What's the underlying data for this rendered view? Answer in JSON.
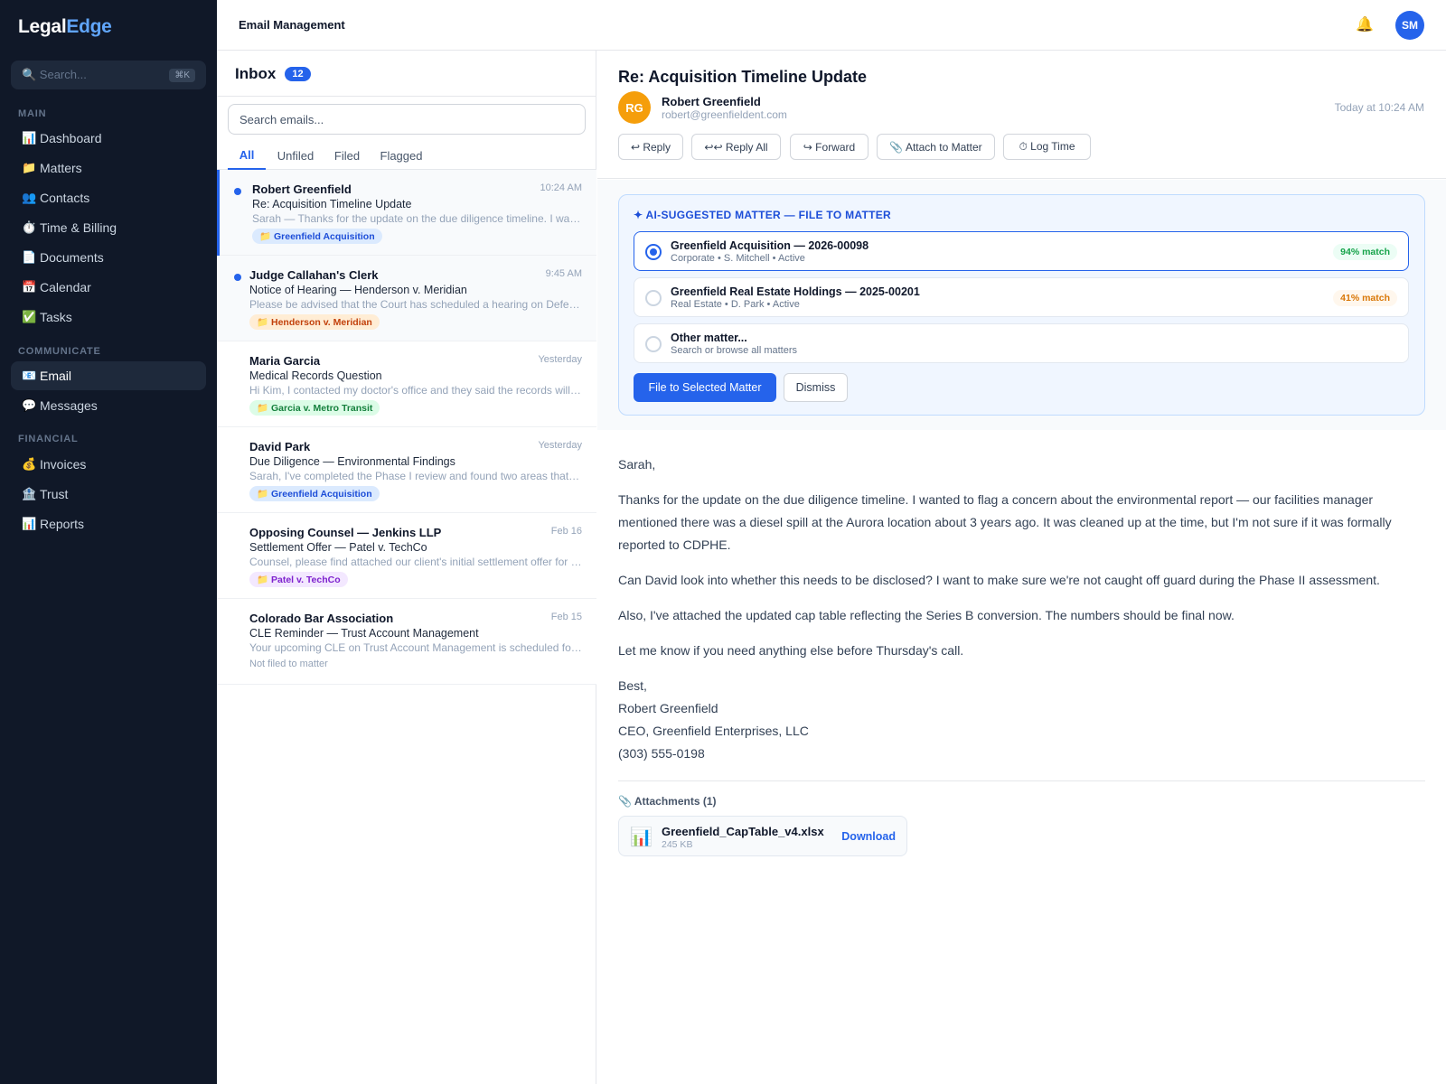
{
  "brand": {
    "part1": "Legal",
    "part2": "Edge"
  },
  "sidebar": {
    "search_placeholder": "🔍 Search...",
    "search_shortcut": "⌘K",
    "sections": {
      "main": "MAIN",
      "communicate": "COMMUNICATE",
      "financial": "FINANCIAL"
    },
    "items": [
      {
        "icon": "📊",
        "label": "Dashboard"
      },
      {
        "icon": "📁",
        "label": "Matters"
      },
      {
        "icon": "👥",
        "label": "Contacts"
      },
      {
        "icon": "⏱️",
        "label": "Time & Billing"
      },
      {
        "icon": "📄",
        "label": "Documents"
      },
      {
        "icon": "📅",
        "label": "Calendar"
      },
      {
        "icon": "✅",
        "label": "Tasks"
      },
      {
        "icon": "📧",
        "label": "Email"
      },
      {
        "icon": "💬",
        "label": "Messages"
      },
      {
        "icon": "💰",
        "label": "Invoices"
      },
      {
        "icon": "🏦",
        "label": "Trust"
      },
      {
        "icon": "📊",
        "label": "Reports"
      }
    ]
  },
  "topbar": {
    "title": "Email Management",
    "bell": "🔔",
    "avatar": "SM"
  },
  "inbox": {
    "title": "Inbox",
    "count": "12",
    "search_placeholder": "Search emails...",
    "tabs": [
      {
        "label": "All"
      },
      {
        "label": "Unfiled"
      },
      {
        "label": "Filed"
      },
      {
        "label": "Flagged"
      }
    ]
  },
  "emails": [
    {
      "sender": "Robert Greenfield",
      "time": "10:24 AM",
      "subject": "Re: Acquisition Timeline Update",
      "preview": "Sarah — Thanks for the update on the due diligence timeline. I wanted to flag a concern about the environmental report",
      "tag": "📁 Greenfield Acquisition"
    },
    {
      "sender": "Judge Callahan's Clerk",
      "time": "9:45 AM",
      "subject": "Notice of Hearing — Henderson v. Meridian",
      "preview": "Please be advised that the Court has scheduled a hearing on Defendant's motion",
      "tag": "📁 Henderson v. Meridian"
    },
    {
      "sender": "Maria Garcia",
      "time": "Yesterday",
      "subject": "Medical Records Question",
      "preview": "Hi Kim, I contacted my doctor's office and they said the records will take two weeks",
      "tag": "📁 Garcia v. Metro Transit"
    },
    {
      "sender": "David Park",
      "time": "Yesterday",
      "subject": "Due Diligence — Environmental Findings",
      "preview": "Sarah, I've completed the Phase I review and found two areas that need attention",
      "tag": "📁 Greenfield Acquisition"
    },
    {
      "sender": "Opposing Counsel — Jenkins LLP",
      "time": "Feb 16",
      "subject": "Settlement Offer — Patel v. TechCo",
      "preview": "Counsel, please find attached our client's initial settlement offer for your consideration",
      "tag": "📁 Patel v. TechCo"
    },
    {
      "sender": "Colorado Bar Association",
      "time": "Feb 15",
      "subject": "CLE Reminder — Trust Account Management",
      "preview": "Your upcoming CLE on Trust Account Management is scheduled for next week",
      "status": "Not filed to matter"
    }
  ],
  "detail": {
    "subject": "Re: Acquisition Timeline Update",
    "avatar": "RG",
    "from_name": "Robert Greenfield",
    "from_email": "robert@greenfieldent.com",
    "time": "Today at 10:24 AM",
    "actions": {
      "reply": "↩ Reply",
      "reply_all": "↩↩ Reply All",
      "forward": "↪ Forward",
      "attach": "📎 Attach to Matter",
      "log_time": "⏱ Log Time"
    }
  },
  "ai_panel": {
    "title": "✦ AI-SUGGESTED MATTER — FILE TO MATTER",
    "options": [
      {
        "name": "Greenfield Acquisition — 2026-00098",
        "meta": "Corporate • S. Mitchell • Active",
        "match": "94% match",
        "selected": true
      },
      {
        "name": "Greenfield Real Estate Holdings — 2025-00201",
        "meta": "Real Estate • D. Park • Active",
        "match": "41% match",
        "selected": false
      },
      {
        "name": "Other matter...",
        "meta": "Search or browse all matters",
        "selected": false
      }
    ],
    "file_button": "File to Selected Matter",
    "dismiss_button": "Dismiss"
  },
  "body": {
    "greeting": "Sarah,",
    "paragraphs": [
      "Thanks for the update on the due diligence timeline. I wanted to flag a concern about the environmental report — our facilities manager mentioned there was a diesel spill at the Aurora location about 3 years ago. It was cleaned up at the time, but I'm not sure if it was formally reported to CDPHE.",
      "Can David look into whether this needs to be disclosed? I want to make sure we're not caught off guard during the Phase II assessment.",
      "Also, I've attached the updated cap table reflecting the Series B conversion. The numbers should be final now.",
      "Let me know if you need anything else before Thursday's call."
    ],
    "signature": [
      "Best,",
      "Robert Greenfield",
      "CEO, Greenfield Enterprises, LLC",
      "(303) 555-0198"
    ]
  },
  "attachments": {
    "header": "📎 Attachments (1)",
    "file": {
      "icon": "📊",
      "name": "Greenfield_CapTable_v4.xlsx",
      "size": "245 KB",
      "download": "Download"
    }
  },
  "colors": {
    "sidebar_bg": "#101828",
    "accent": "#2563eb",
    "tag_blue_bg": "#dbeafe",
    "tag_blue_fg": "#1d4ed8",
    "tag_orange_bg": "#ffedd5",
    "tag_orange_fg": "#c2410c",
    "tag_green_bg": "#dcfce7",
    "tag_green_fg": "#15803d",
    "tag_purple_bg": "#f3e8ff",
    "tag_purple_fg": "#7e22ce"
  }
}
